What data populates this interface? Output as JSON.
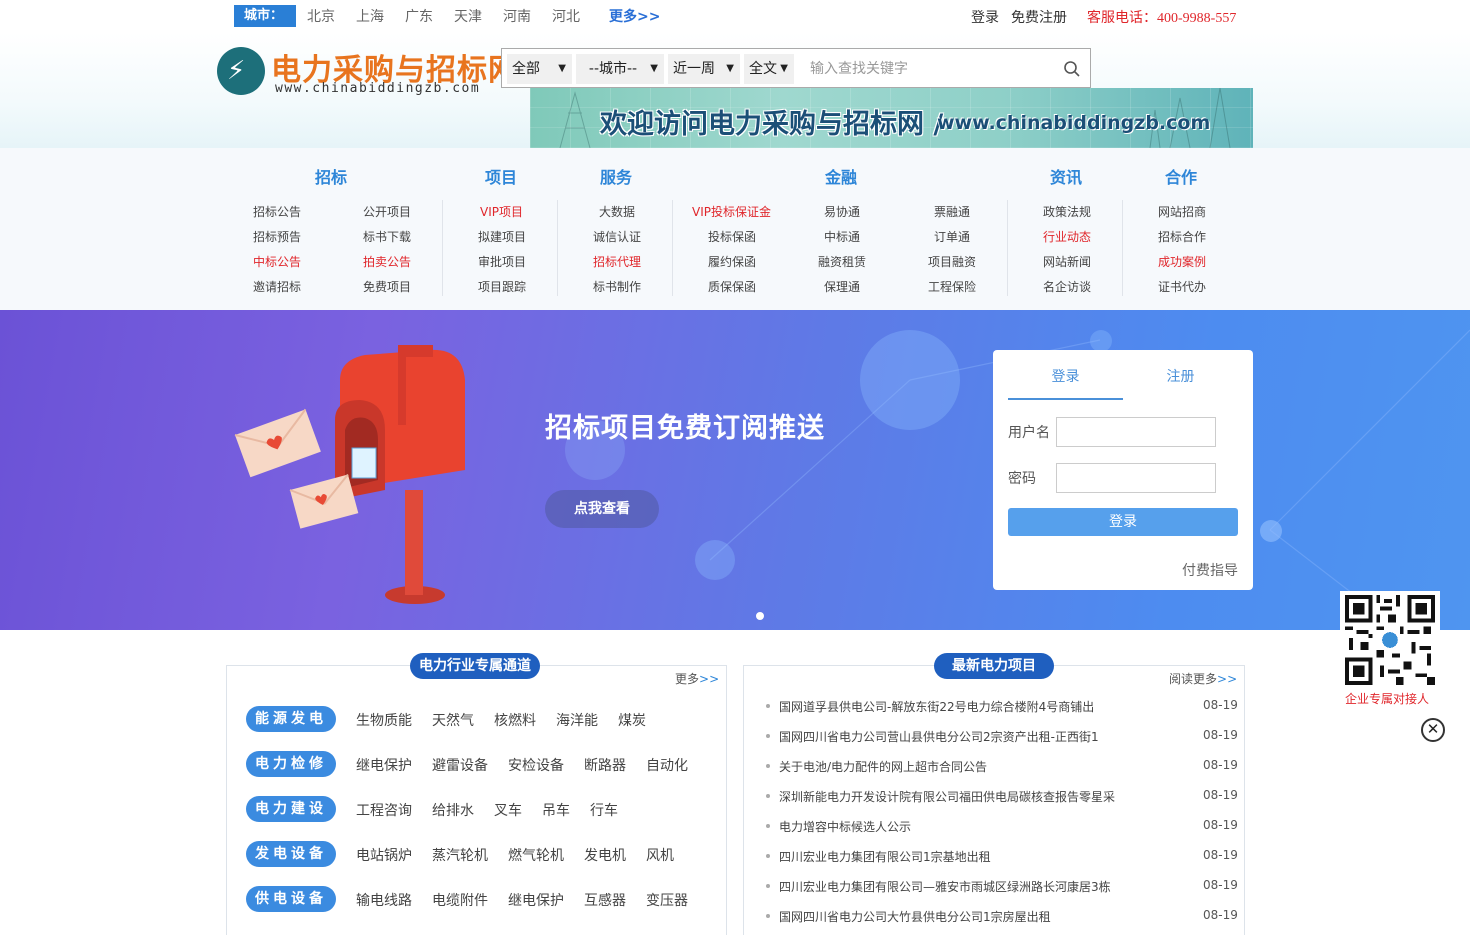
{
  "topbar": {
    "city_label": "城市：",
    "cities": [
      "北京",
      "上海",
      "广东",
      "天津",
      "河南",
      "河北"
    ],
    "more": "更多>>",
    "login": "登录",
    "register": "免费注册",
    "hotline": "客服电话：400-9988-557"
  },
  "header": {
    "logo_title": "电力采购与招标网",
    "logo_url": "www.chinabiddingzb.com",
    "banner_text": "欢迎访问电力采购与招标网 /",
    "banner_url": "www.chinabiddingzb.com"
  },
  "search": {
    "scope": "全部",
    "city": "--城市--",
    "period": "近一周",
    "mode": "全文",
    "placeholder": "输入查找关键字"
  },
  "nav": {
    "heads": [
      "招标",
      "项目",
      "服务",
      "金融",
      "资讯",
      "合作"
    ],
    "columns": [
      [
        "招标公告",
        "招标预告",
        "中标公告",
        "邀请招标"
      ],
      [
        "公开项目",
        "标书下载",
        "拍卖公告",
        "免费项目"
      ],
      [
        "VIP项目",
        "拟建项目",
        "审批项目",
        "项目跟踪"
      ],
      [
        "大数据",
        "诚信认证",
        "招标代理",
        "标书制作"
      ],
      [
        "VIP投标保证金",
        "投标保函",
        "履约保函",
        "质保保函"
      ],
      [
        "易协通",
        "中标通",
        "融资租赁",
        "保理通"
      ],
      [
        "票融通",
        "订单通",
        "项目融资",
        "工程保险"
      ],
      [
        "政策法规",
        "行业动态",
        "网站新闻",
        "名企访谈"
      ],
      [
        "网站招商",
        "招标合作",
        "成功案例",
        "证书代办"
      ]
    ],
    "highlight_color": "#e0262b"
  },
  "hero": {
    "title": "招标项目免费订阅推送",
    "button": "点我查看"
  },
  "login": {
    "tab_login": "登录",
    "tab_register": "注册",
    "username_label": "用户名",
    "password_label": "密码",
    "submit": "登录",
    "pay_guide": "付费指导"
  },
  "qr": {
    "label": "企业专属对接人"
  },
  "industry": {
    "title": "电力行业专属通道",
    "more": "更多",
    "more_arrow": ">>",
    "rows": [
      {
        "label": "能源发电",
        "items": [
          "生物质能",
          "天然气",
          "核燃料",
          "海洋能",
          "煤炭"
        ]
      },
      {
        "label": "电力检修",
        "items": [
          "继电保护",
          "避雷设备",
          "安检设备",
          "断路器",
          "自动化"
        ]
      },
      {
        "label": "电力建设",
        "items": [
          "工程咨询",
          "给排水",
          "叉车",
          "吊车",
          "行车"
        ]
      },
      {
        "label": "发电设备",
        "items": [
          "电站锅炉",
          "蒸汽轮机",
          "燃气轮机",
          "发电机",
          "风机"
        ]
      },
      {
        "label": "供电设备",
        "items": [
          "输电线路",
          "电缆附件",
          "继电保护",
          "互感器",
          "变压器"
        ]
      }
    ]
  },
  "latest": {
    "title": "最新电力项目",
    "more": "阅读更多",
    "more_arrow": ">>",
    "items": [
      {
        "title": "国网道孚县供电公司-解放东街22号电力综合楼附4号商铺出",
        "date": "08-19"
      },
      {
        "title": "国网四川省电力公司营山县供电分公司2宗资产出租-正西街1",
        "date": "08-19"
      },
      {
        "title": "关于电池/电力配件的网上超市合同公告",
        "date": "08-19"
      },
      {
        "title": "深圳新能电力开发设计院有限公司福田供电局碳核查报告零星采",
        "date": "08-19"
      },
      {
        "title": "电力增容中标候选人公示",
        "date": "08-19"
      },
      {
        "title": "四川宏业电力集团有限公司1宗基地出租",
        "date": "08-19"
      },
      {
        "title": "四川宏业电力集团有限公司—雅安市雨城区绿洲路长河康居3栋",
        "date": "08-19"
      },
      {
        "title": "国网四川省电力公司大竹县供电分公司1宗房屋出租",
        "date": "08-19"
      }
    ]
  }
}
